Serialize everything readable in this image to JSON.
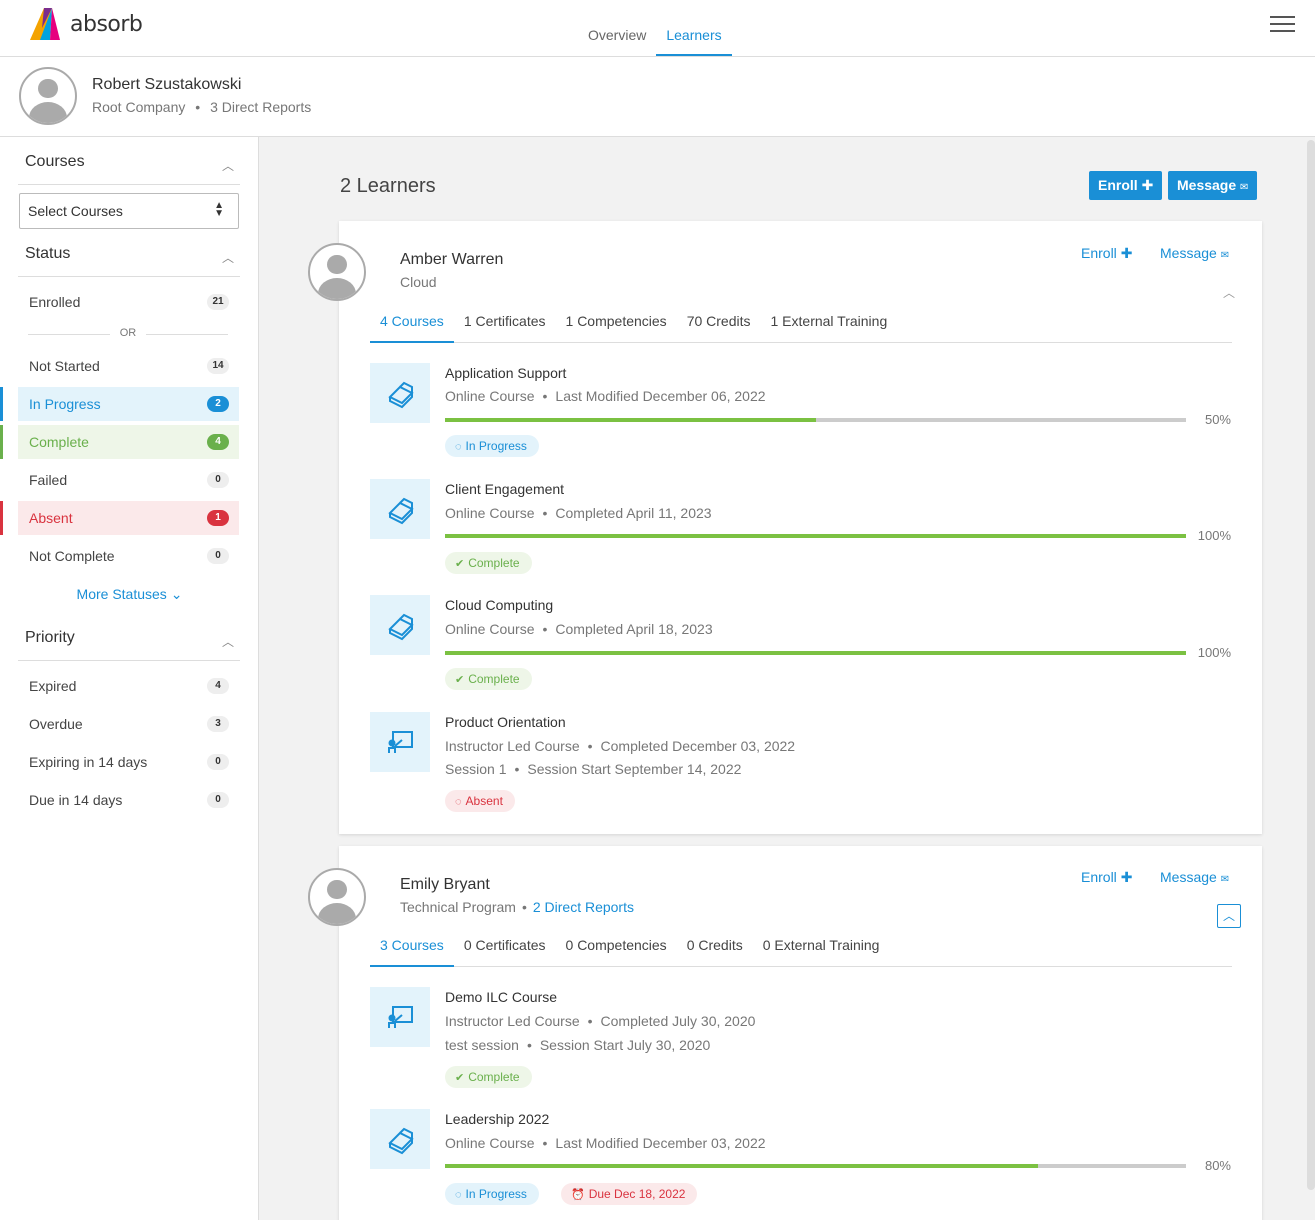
{
  "app": {
    "logo_text": "absorb",
    "nav": [
      "Overview",
      "Learners"
    ],
    "active_nav": 1
  },
  "user": {
    "name": "Robert Szustakowski",
    "company": "Root Company",
    "reports": "3 Direct Reports",
    "sep": "•"
  },
  "sidebar": {
    "courses": {
      "title": "Courses",
      "select_value": "Select Courses"
    },
    "status": {
      "title": "Status",
      "or": "OR",
      "items": [
        {
          "label": "Enrolled",
          "count": "21"
        },
        {
          "label": "Not Started",
          "count": "14"
        },
        {
          "label": "In Progress",
          "count": "2"
        },
        {
          "label": "Complete",
          "count": "4"
        },
        {
          "label": "Failed",
          "count": "0"
        },
        {
          "label": "Absent",
          "count": "1"
        },
        {
          "label": "Not Complete",
          "count": "0"
        }
      ],
      "more": "More Statuses"
    },
    "priority": {
      "title": "Priority",
      "items": [
        {
          "label": "Expired",
          "count": "4"
        },
        {
          "label": "Overdue",
          "count": "3"
        },
        {
          "label": "Expiring in 14 days",
          "count": "0"
        },
        {
          "label": "Due in 14 days",
          "count": "0"
        }
      ]
    }
  },
  "main": {
    "title": "2 Learners",
    "enroll": "Enroll",
    "message": "Message",
    "learners": [
      {
        "name": "Amber Warren",
        "sub": "Cloud",
        "tabs": [
          "4 Courses",
          "1 Certificates",
          "1 Competencies",
          "70 Credits",
          "1 External Training"
        ],
        "courses": [
          {
            "title": "Application Support",
            "meta": "Online Course",
            "sep": "•",
            "meta2": "Last Modified December 06, 2022",
            "progress": 50,
            "pct": "50%",
            "status": "In Progress"
          },
          {
            "title": "Client Engagement",
            "meta": "Online Course",
            "sep": "•",
            "meta2": "Completed April 11, 2023",
            "progress": 100,
            "pct": "100%",
            "status": "Complete"
          },
          {
            "title": "Cloud Computing",
            "meta": "Online Course",
            "sep": "•",
            "meta2": "Completed April 18, 2023",
            "progress": 100,
            "pct": "100%",
            "status": "Complete"
          },
          {
            "title": "Product Orientation",
            "meta": "Instructor Led Course",
            "sep": "•",
            "meta2": "Completed December 03, 2022",
            "session": "Session 1",
            "session2": "Session Start September 14, 2022",
            "status": "Absent"
          }
        ]
      },
      {
        "name": "Emily Bryant",
        "sub": "Technical Program",
        "sub_sep": "•",
        "sub_link": "2 Direct Reports",
        "tabs": [
          "3 Courses",
          "0 Certificates",
          "0 Competencies",
          "0 Credits",
          "0 External Training"
        ],
        "courses": [
          {
            "title": "Demo ILC Course",
            "meta": "Instructor Led Course",
            "sep": "•",
            "meta2": "Completed July 30, 2020",
            "session": "test session",
            "session2": "Session Start July 30, 2020",
            "status": "Complete"
          },
          {
            "title": "Leadership 2022",
            "meta": "Online Course",
            "sep": "•",
            "meta2": "Last Modified December 03, 2022",
            "progress": 80,
            "pct": "80%",
            "status": "In Progress",
            "due": "Due Dec 18, 2022"
          }
        ]
      }
    ]
  },
  "colors": {
    "accent": "#1a8fd6",
    "complete": "#6ab04c",
    "absent": "#d9333f",
    "progress": "#7bc142"
  }
}
